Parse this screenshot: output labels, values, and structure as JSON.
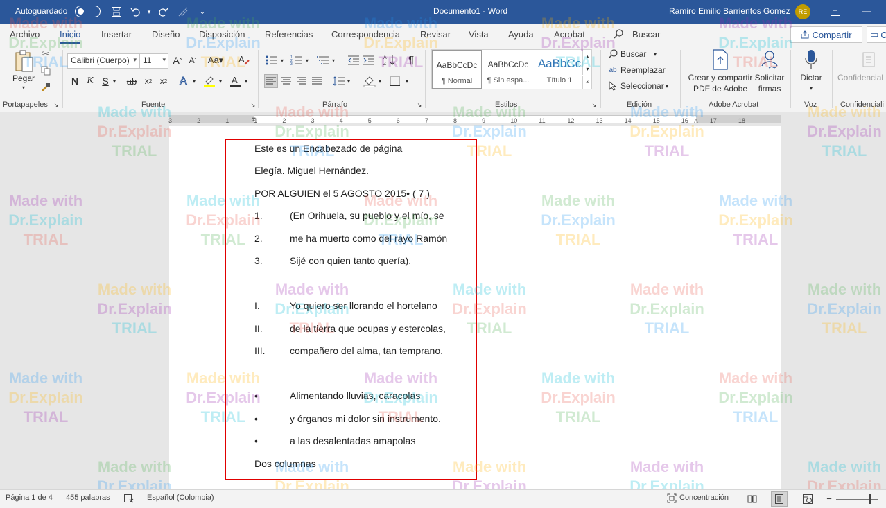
{
  "titlebar": {
    "autosave_label": "Autoguardado",
    "doc_title": "Documento1  -  Word",
    "user_name": "Ramiro Emilio Barrientos Gomez",
    "user_initials": "RE"
  },
  "menu": {
    "items": [
      "Archivo",
      "Inicio",
      "Insertar",
      "Diseño",
      "Disposición",
      "Referencias",
      "Correspondencia",
      "Revisar",
      "Vista",
      "Ayuda",
      "Acrobat"
    ],
    "search_placeholder": "Buscar",
    "share_label": "Compartir",
    "comment_label": "Co"
  },
  "ribbon": {
    "clipboard": {
      "paste_label": "Pegar",
      "group_label": "Portapapeles"
    },
    "font": {
      "font_name": "Calibri (Cuerpo)",
      "font_size": "11",
      "group_label": "Fuente",
      "bold": "N",
      "italic": "K",
      "underline": "S",
      "strike": "ab"
    },
    "paragraph": {
      "group_label": "Párrafo"
    },
    "styles": {
      "group_label": "Estilos",
      "items": [
        {
          "preview": "AaBbCcDc",
          "name": "¶ Normal"
        },
        {
          "preview": "AaBbCcDc",
          "name": "¶ Sin espa..."
        },
        {
          "preview": "AaBbCc",
          "name": "Título 1"
        }
      ]
    },
    "editing": {
      "group_label": "Edición",
      "find": "Buscar",
      "replace": "Reemplazar",
      "select": "Seleccionar"
    },
    "adobe": {
      "group_label": "Adobe Acrobat",
      "create_label_1": "Crear y compartir",
      "create_label_2": "PDF de Adobe",
      "request_label_1": "Solicitar",
      "request_label_2": "firmas"
    },
    "voice": {
      "group_label": "Voz",
      "dictate_label": "Dictar"
    },
    "sensitivity": {
      "group_label": "Confidenciali",
      "label": "Confidencial"
    }
  },
  "ruler": {
    "ticks": [
      "3",
      "2",
      "1",
      "1",
      "2",
      "3",
      "4",
      "5",
      "6",
      "7",
      "8",
      "9",
      "10",
      "11",
      "12",
      "13",
      "14",
      "15",
      "16",
      "17",
      "18"
    ]
  },
  "document": {
    "header": "Este es un Encabezado de página",
    "title": "Elegía. Miguel Hernández.",
    "byline": "POR ALGUIEN el 5 AGOSTO 2015• ",
    "byline_link": "( 7 )",
    "numbered": [
      {
        "marker": "1.",
        "text": "(En Orihuela, su pueblo y el mío, se"
      },
      {
        "marker": "2.",
        "text": "me ha muerto como del rayo Ramón"
      },
      {
        "marker": "3.",
        "text": "Sijé con quien tanto quería)."
      }
    ],
    "roman": [
      {
        "marker": "I.",
        "text": "Yo quiero ser llorando el hortelano"
      },
      {
        "marker": "II.",
        "text": "de la tierra que ocupas y estercolas,"
      },
      {
        "marker": "III.",
        "text": "compañero del alma, tan temprano."
      }
    ],
    "bullets": [
      {
        "marker": "•",
        "text": "Alimentando lluvias, caracolas"
      },
      {
        "marker": "•",
        "text": "y órganos mi dolor sin instrumento."
      },
      {
        "marker": "•",
        "text": "a las desalentadas amapolas"
      }
    ],
    "footer_line": "Dos columnas"
  },
  "watermark": {
    "line1": "Made with",
    "line2": "Dr.Explain",
    "line3": "TRIAL"
  },
  "status": {
    "page": "Página 1 de 4",
    "words": "455 palabras",
    "language": "Español (Colombia)",
    "focus": "Concentración"
  },
  "colors": {
    "brand": "#2b579a",
    "highlight_box": "#e00000",
    "avatar": "#c19c00"
  }
}
